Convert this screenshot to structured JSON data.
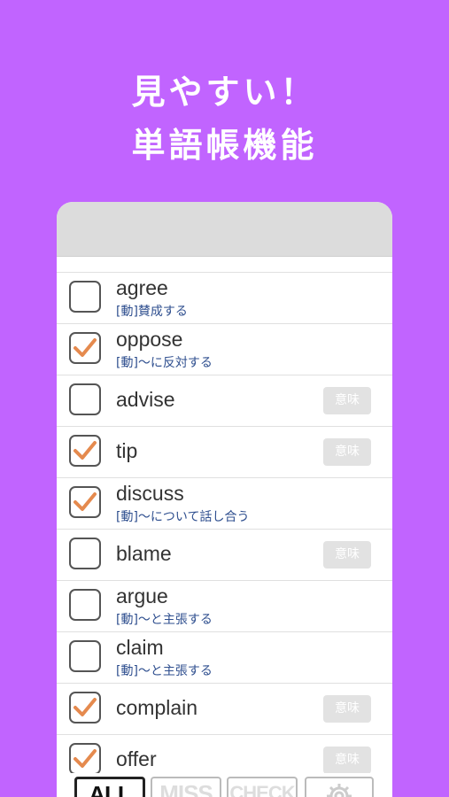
{
  "headline": {
    "line1": "見やすい！",
    "line2": "単語帳機能"
  },
  "accent_color": "#c164ff",
  "check_color": "#e58a4e",
  "words": [
    {
      "word": "agree",
      "checked": false,
      "meaning": "[動]賛成する",
      "meaning_button": ""
    },
    {
      "word": "oppose",
      "checked": true,
      "meaning": "[動]〜に反対する",
      "meaning_button": ""
    },
    {
      "word": "advise",
      "checked": false,
      "meaning": "",
      "meaning_button": "意味"
    },
    {
      "word": "tip",
      "checked": true,
      "meaning": "",
      "meaning_button": "意味"
    },
    {
      "word": "discuss",
      "checked": true,
      "meaning": "[動]〜について話し合う",
      "meaning_button": ""
    },
    {
      "word": "blame",
      "checked": false,
      "meaning": "",
      "meaning_button": "意味"
    },
    {
      "word": "argue",
      "checked": false,
      "meaning": "[動]〜と主張する",
      "meaning_button": ""
    },
    {
      "word": "claim",
      "checked": false,
      "meaning": "[動]〜と主張する",
      "meaning_button": ""
    },
    {
      "word": "complain",
      "checked": true,
      "meaning": "",
      "meaning_button": "意味"
    },
    {
      "word": "offer",
      "checked": true,
      "meaning": "",
      "meaning_button": "意味"
    }
  ],
  "tabs": {
    "all": "ALL",
    "miss": "MISS",
    "check": "CHECK",
    "settings_icon": "gear-icon"
  }
}
